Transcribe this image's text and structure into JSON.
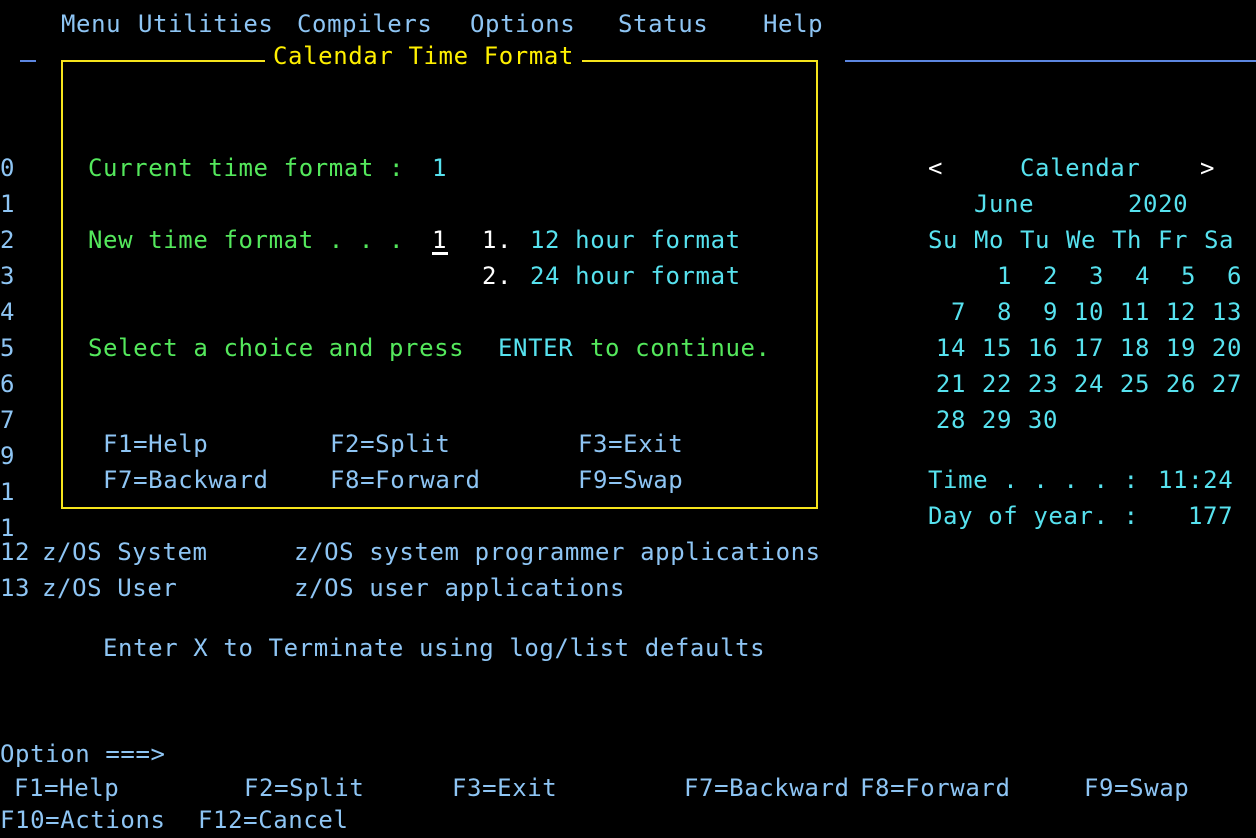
{
  "menubar": {
    "items": [
      "Menu",
      "Utilities",
      "Compilers",
      "Options",
      "Status",
      "Help"
    ]
  },
  "left_numbers": [
    "0",
    "1",
    "2",
    "3",
    "4",
    "5",
    "6",
    "7",
    "9",
    "1",
    "1"
  ],
  "dialog": {
    "title": "Calendar Time Format",
    "current_label": "Current time format :",
    "current_value": "1",
    "new_label": "New time format . . .",
    "new_value": "1",
    "choice1_num": "1.",
    "choice1_text": "12 hour format",
    "choice2_num": "2.",
    "choice2_text": "24 hour format",
    "instr_prefix": "Select a choice and press",
    "instr_key": "ENTER",
    "instr_suffix": "to continue.",
    "fkeys": [
      [
        "F1=Help",
        "F2=Split",
        "F3=Exit"
      ],
      [
        "F7=Backward",
        "F8=Forward",
        "F9=Swap"
      ]
    ]
  },
  "calendar": {
    "prev": "<",
    "title": "Calendar",
    "next": ">",
    "month": "June",
    "year": "2020",
    "weekdays": [
      "Su",
      "Mo",
      "Tu",
      "We",
      "Th",
      "Fr",
      "Sa"
    ],
    "weeks": [
      [
        "",
        "1",
        "2",
        "3",
        "4",
        "5",
        "6"
      ],
      [
        "7",
        "8",
        "9",
        "10",
        "11",
        "12",
        "13"
      ],
      [
        "14",
        "15",
        "16",
        "17",
        "18",
        "19",
        "20"
      ],
      [
        "21",
        "22",
        "23",
        "24",
        "25",
        "26",
        "27"
      ],
      [
        "28",
        "29",
        "30",
        "",
        "",
        "",
        ""
      ]
    ],
    "time_label": "Time . . . . :",
    "time_value": "11:24",
    "doy_label": "Day of year. :",
    "doy_value": "177"
  },
  "options": [
    {
      "num": "12",
      "name": "z/OS System",
      "desc": "z/OS system programmer applications"
    },
    {
      "num": "13",
      "name": "z/OS User",
      "desc": "z/OS user applications"
    }
  ],
  "terminate_text": "Enter X to Terminate using log/list defaults",
  "command": {
    "label": "Option ===>",
    "value": ""
  },
  "pfkeys_row1": [
    "F1=Help",
    "F2=Split",
    "F3=Exit",
    "F7=Backward",
    "F8=Forward",
    "F9=Swap"
  ],
  "pfkeys_row2": [
    "F10=Actions",
    "F12=Cancel"
  ]
}
